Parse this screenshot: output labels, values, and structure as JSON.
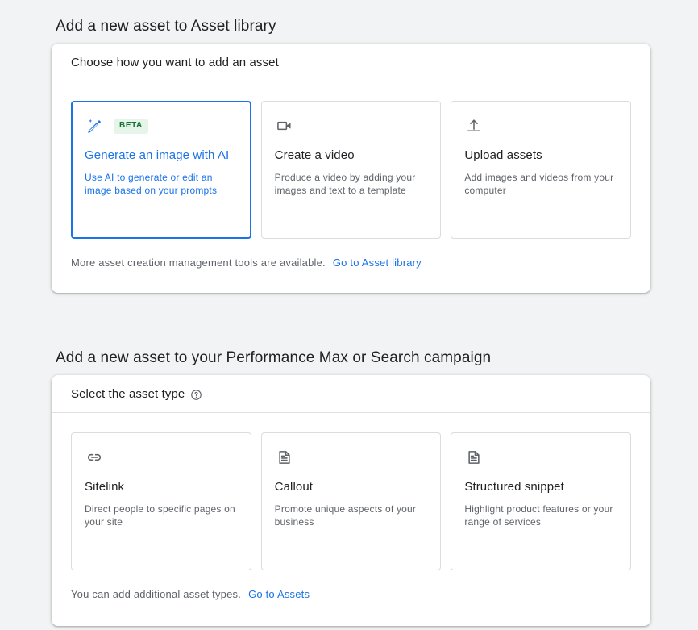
{
  "sections": [
    {
      "heading": "Add a new asset to Asset library",
      "panel": {
        "header_title": "Choose how you want to add an asset",
        "cards": [
          {
            "icon": "magic-wand-ai-icon",
            "badge": "BETA",
            "title": "Generate an image with AI",
            "desc": "Use AI to generate or edit an image based on your prompts",
            "selected": true
          },
          {
            "icon": "video-camera-icon",
            "badge": "",
            "title": "Create a video",
            "desc": "Produce a video by adding your images and text to a template",
            "selected": false
          },
          {
            "icon": "upload-icon",
            "badge": "",
            "title": "Upload assets",
            "desc": "Add images and videos from your computer",
            "selected": false
          }
        ],
        "footer_text": "More asset creation management tools are available.",
        "footer_link": "Go to Asset library"
      }
    },
    {
      "heading": "Add a new asset to your Performance Max or Search campaign",
      "panel": {
        "header_title": "Select the asset type",
        "header_help_icon": "help-circle-icon",
        "cards": [
          {
            "icon": "link-chain-icon",
            "badge": "",
            "title": "Sitelink",
            "desc": "Direct people to specific pages on your site",
            "selected": false
          },
          {
            "icon": "document-lines-icon",
            "badge": "",
            "title": "Callout",
            "desc": "Promote unique aspects of your business",
            "selected": false
          },
          {
            "icon": "document-lines-icon",
            "badge": "",
            "title": "Structured snippet",
            "desc": "Highlight product features or your range of services",
            "selected": false
          }
        ],
        "footer_text": "You can add additional asset types.",
        "footer_link": "Go to Assets"
      }
    }
  ],
  "colors": {
    "background": "#f1f3f4",
    "panel": "#ffffff",
    "accent_blue": "#1a73e8",
    "text_primary": "#202124",
    "text_secondary": "#5f6368",
    "badge_bg": "#e6f4ea",
    "badge_text": "#137333",
    "border": "#dadce0"
  }
}
